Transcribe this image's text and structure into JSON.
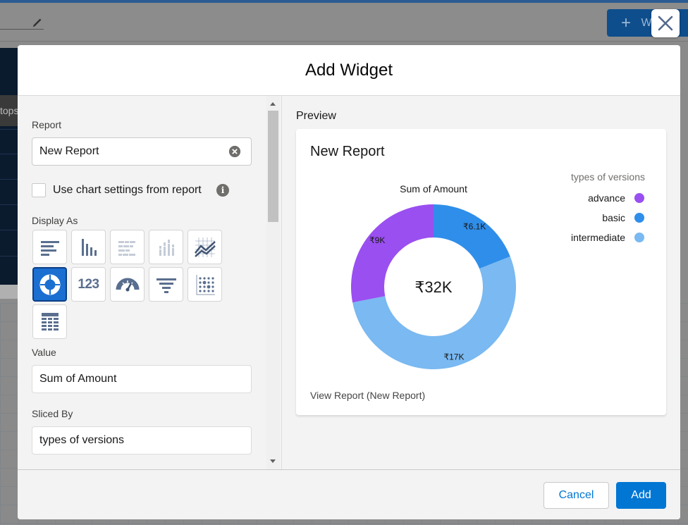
{
  "background": {
    "new_button_label": "W",
    "side_text": "tops"
  },
  "modal": {
    "title": "Add Widget",
    "close_label": "Close"
  },
  "form": {
    "report_label": "Report",
    "report_value": "New Report",
    "use_chart_settings_label": "Use chart settings from report",
    "use_chart_settings_checked": false,
    "display_as_label": "Display As",
    "chart_type_options": [
      {
        "name": "horizontal-bar-chart",
        "selected": false
      },
      {
        "name": "vertical-bar-chart",
        "selected": false
      },
      {
        "name": "stacked-horizontal-bar-chart",
        "selected": false
      },
      {
        "name": "stacked-vertical-bar-chart",
        "selected": false
      },
      {
        "name": "line-chart",
        "selected": false
      },
      {
        "name": "donut-chart",
        "selected": true
      },
      {
        "name": "metric",
        "label": "123",
        "selected": false
      },
      {
        "name": "gauge",
        "selected": false
      },
      {
        "name": "funnel-chart",
        "selected": false
      },
      {
        "name": "scatter-chart",
        "selected": false
      },
      {
        "name": "table",
        "selected": false
      }
    ],
    "value_label": "Value",
    "value_value": "Sum of Amount",
    "sliced_by_label": "Sliced By",
    "sliced_by_value": "types of versions"
  },
  "preview": {
    "label": "Preview",
    "card_title": "New Report",
    "link_text": "View Report (New Report)"
  },
  "chart_data": {
    "type": "pie",
    "subtype": "donut",
    "title": "Sum of Amount",
    "center_label": "₹32K",
    "legend_title": "types of versions",
    "legend_position": "top-right",
    "categories": [
      "advance",
      "basic",
      "intermediate"
    ],
    "values": [
      9000,
      6100,
      17000
    ],
    "value_labels": [
      "₹9K",
      "₹6.1K",
      "₹17K"
    ],
    "colors": [
      "#9a4ff0",
      "#2f8eea",
      "#7ab9f1"
    ]
  },
  "footer": {
    "cancel_label": "Cancel",
    "add_label": "Add"
  },
  "colors": {
    "brand": "#0176d3",
    "selected_chart_type": "#1b6fd1"
  }
}
